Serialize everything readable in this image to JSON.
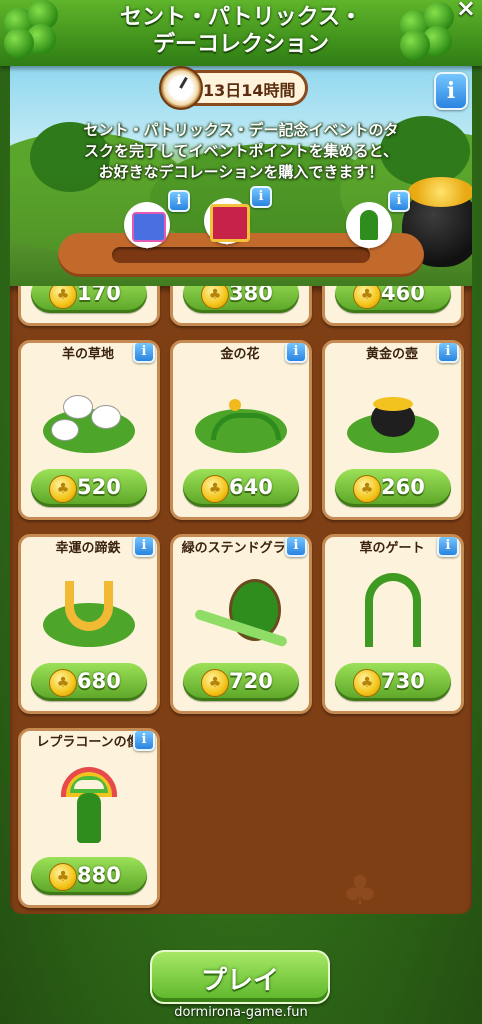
{
  "title_line1": "セント・パトリックス・",
  "title_line2": "デーコレクション",
  "close_label": "×",
  "timer": "13日14時間",
  "info_label": "i",
  "description_line1": "セント・パトリックス・デー記念イベントのタ",
  "description_line2": "スクを完了してイベントポイントを集めると、",
  "description_line3": "お好きなデコレーションを購入できます！",
  "progress_fraction": 0,
  "top_row_prices": [
    "170",
    "380",
    "460"
  ],
  "items": [
    {
      "name": "羊の草地",
      "price": "520"
    },
    {
      "name": "金の花",
      "price": "640"
    },
    {
      "name": "黄金の壺",
      "price": "260"
    },
    {
      "name": "幸運の蹄鉄",
      "price": "680"
    },
    {
      "name": "緑のステンドグラス",
      "price": "720"
    },
    {
      "name": "草のゲート",
      "price": "730"
    },
    {
      "name": "レプラコーンの像",
      "price": "880"
    }
  ],
  "play_label": "プレイ",
  "watermark": "dormirona-game.fun",
  "colors": {
    "accent_green": "#5aa326",
    "board_brown": "#7f3f15",
    "card_bg": "#fdf3dc",
    "info_blue": "#2a84e0"
  }
}
